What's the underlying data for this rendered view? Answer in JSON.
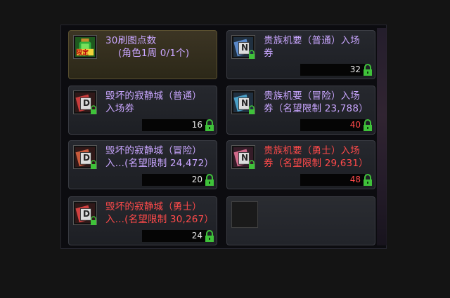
{
  "items": [
    {
      "title": "30刷图点数\n    (角色1周 0/1个)",
      "quantity": "",
      "title_color": "purple",
      "icon": "potion-limited-icon",
      "icon_label": "限定",
      "highlighted": true
    },
    {
      "title": "贵族机要（普通）入场\n券",
      "quantity": "32",
      "title_color": "purple",
      "icon": "ticket-n-blue-icon",
      "icon_letter": "N"
    },
    {
      "title": "毁坏的寂静城（普通）\n入场券",
      "quantity": "16",
      "title_color": "purple",
      "icon": "ticket-d-red-icon",
      "icon_letter": "D"
    },
    {
      "title": "贵族机要（冒险）入场\n券（名望限制 23,788）",
      "quantity": "40",
      "title_color": "purple",
      "quantity_color": "red",
      "icon": "ticket-n-blue-icon",
      "icon_letter": "N"
    },
    {
      "title": "毁坏的寂静城（冒险）\n入...(名望限制 24,472）",
      "quantity": "20",
      "title_color": "purple",
      "icon": "ticket-d-red-icon",
      "icon_letter": "D"
    },
    {
      "title": "贵族机要（勇士）入场\n券（名望限制 29,631）",
      "quantity": "48",
      "title_color": "red",
      "quantity_color": "red",
      "icon": "ticket-n-pink-icon",
      "icon_letter": "N"
    },
    {
      "title": "毁坏的寂静城（勇士）\n入...(名望限制 30,267）",
      "quantity": "24",
      "title_color": "red",
      "icon": "ticket-d-red-icon",
      "icon_letter": "D"
    },
    {
      "title": "",
      "quantity": "",
      "empty": true
    }
  ],
  "colors": {
    "purple": "#c9a6ff",
    "red": "#ff4a4a",
    "lock_green": "#3fc23a"
  }
}
